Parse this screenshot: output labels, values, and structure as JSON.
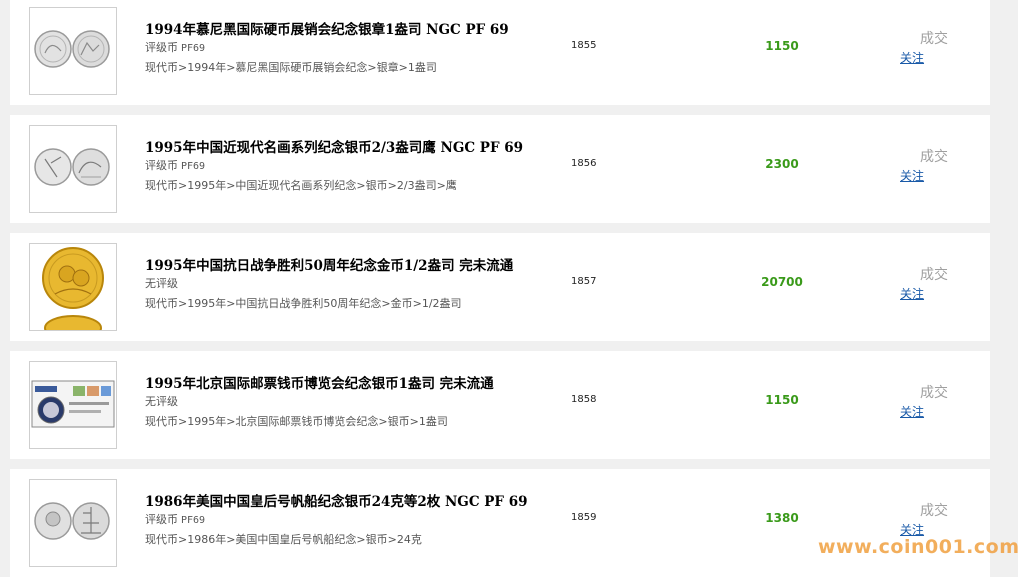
{
  "colors": {
    "price": "#3a9a1a",
    "link": "#1a5aa8",
    "status": "#a0a0a0",
    "page_background": "#f0f0f0"
  },
  "listings": [
    {
      "title": "1994年慕尼黑国际硬币展销会纪念银章1盎司 NGC PF 69",
      "grade_label": "评级币",
      "grade_code": "PF69",
      "path": "现代币>1994年>慕尼黑国际硬币展销会纪念>银章>1盎司",
      "lot": "1855",
      "price": "1150",
      "status": "成交",
      "follow": "关注",
      "thumb_icon": "silver-coin-pair-icon"
    },
    {
      "title": "1995年中国近现代名画系列纪念银币2/3盎司鹰 NGC PF 69",
      "grade_label": "评级币",
      "grade_code": "PF69",
      "path": "现代币>1995年>中国近现代名画系列纪念>银币>2/3盎司>鹰",
      "lot": "1856",
      "price": "2300",
      "status": "成交",
      "follow": "关注",
      "thumb_icon": "silver-coin-pair-icon"
    },
    {
      "title": "1995年中国抗日战争胜利50周年纪念金币1/2盎司 完未流通",
      "grade_label": "无评级",
      "grade_code": "",
      "path": "现代币>1995年>中国抗日战争胜利50周年纪念>金币>1/2盎司",
      "lot": "1857",
      "price": "20700",
      "status": "成交",
      "follow": "关注",
      "thumb_icon": "gold-coin-icon"
    },
    {
      "title": "1995年北京国际邮票钱币博览会纪念银币1盎司 完未流通",
      "grade_label": "无评级",
      "grade_code": "",
      "path": "现代币>1995年>北京国际邮票钱币博览会纪念>银币>1盎司",
      "lot": "1858",
      "price": "1150",
      "status": "成交",
      "follow": "关注",
      "thumb_icon": "coin-cover-icon"
    },
    {
      "title": "1986年美国中国皇后号帆船纪念银币24克等2枚 NGC PF 69",
      "grade_label": "评级币",
      "grade_code": "PF69",
      "path": "现代币>1986年>美国中国皇后号帆船纪念>银币>24克",
      "lot": "1859",
      "price": "1380",
      "status": "成交",
      "follow": "关注",
      "thumb_icon": "silver-coin-pair-icon"
    }
  ],
  "watermark": "www.coin001.com"
}
